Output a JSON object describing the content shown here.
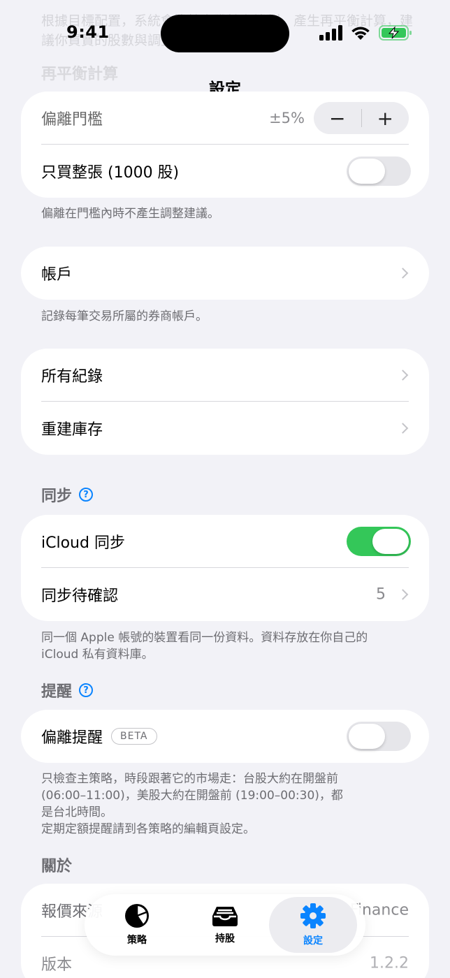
{
  "status_bar": {
    "time": "9:41"
  },
  "nav": {
    "title": "設定"
  },
  "behind": {
    "intro_text": "根據目標配置，系統會比較實際持有比例，產生再平衡計算，建議你買賣的股數與調整方式。",
    "section_title": "再平衡計算"
  },
  "rebalance": {
    "threshold_label": "偏離門檻",
    "threshold_value": "±5%",
    "minus": "−",
    "plus": "+",
    "whole_lot_label": "只買整張 (1000 股)",
    "whole_lot_on": false,
    "footnote": "偏離在門檻內時不產生調整建議。"
  },
  "accounts": {
    "label": "帳戶",
    "footnote": "記錄每筆交易所屬的券商帳戶。"
  },
  "records": {
    "all_label": "所有紀錄",
    "rebuild_label": "重建庫存"
  },
  "sync": {
    "header": "同步",
    "help": "?",
    "icloud_label": "iCloud 同步",
    "icloud_on": true,
    "pending_label": "同步待確認",
    "pending_count": "5",
    "footnote_1": "同一個 Apple 帳號的裝置看同一份資料。資料存放在你自己的",
    "footnote_2": "iCloud 私有資料庫。"
  },
  "reminder": {
    "header": "提醒",
    "help": "?",
    "deviation_label": "偏離提醒",
    "beta": "BETA",
    "deviation_on": false,
    "footnote_1": "只檢查主策略，時段跟著它的市場走：台股大約在開盤前",
    "footnote_2": "(06:00–11:00)，美股大約在開盤前 (19:00–00:30)，都",
    "footnote_3": "是台北時間。",
    "footnote_4": "定期定額提醒請到各策略的編輯頁設定。"
  },
  "about": {
    "header": "關於",
    "quote_source_label": "報價來源",
    "quote_source_value": "Yahoo Finance",
    "version_label": "版本",
    "version_value": "1.2.2"
  },
  "tabbar": {
    "tabs": [
      {
        "label": "策略",
        "icon": "pie-chart-icon"
      },
      {
        "label": "持股",
        "icon": "tray-icon"
      },
      {
        "label": "設定",
        "icon": "gear-icon"
      }
    ],
    "active": "設定"
  },
  "colors": {
    "accent": "#0a84ff",
    "toggle_on": "#34c759",
    "background": "#f2f2f7"
  }
}
